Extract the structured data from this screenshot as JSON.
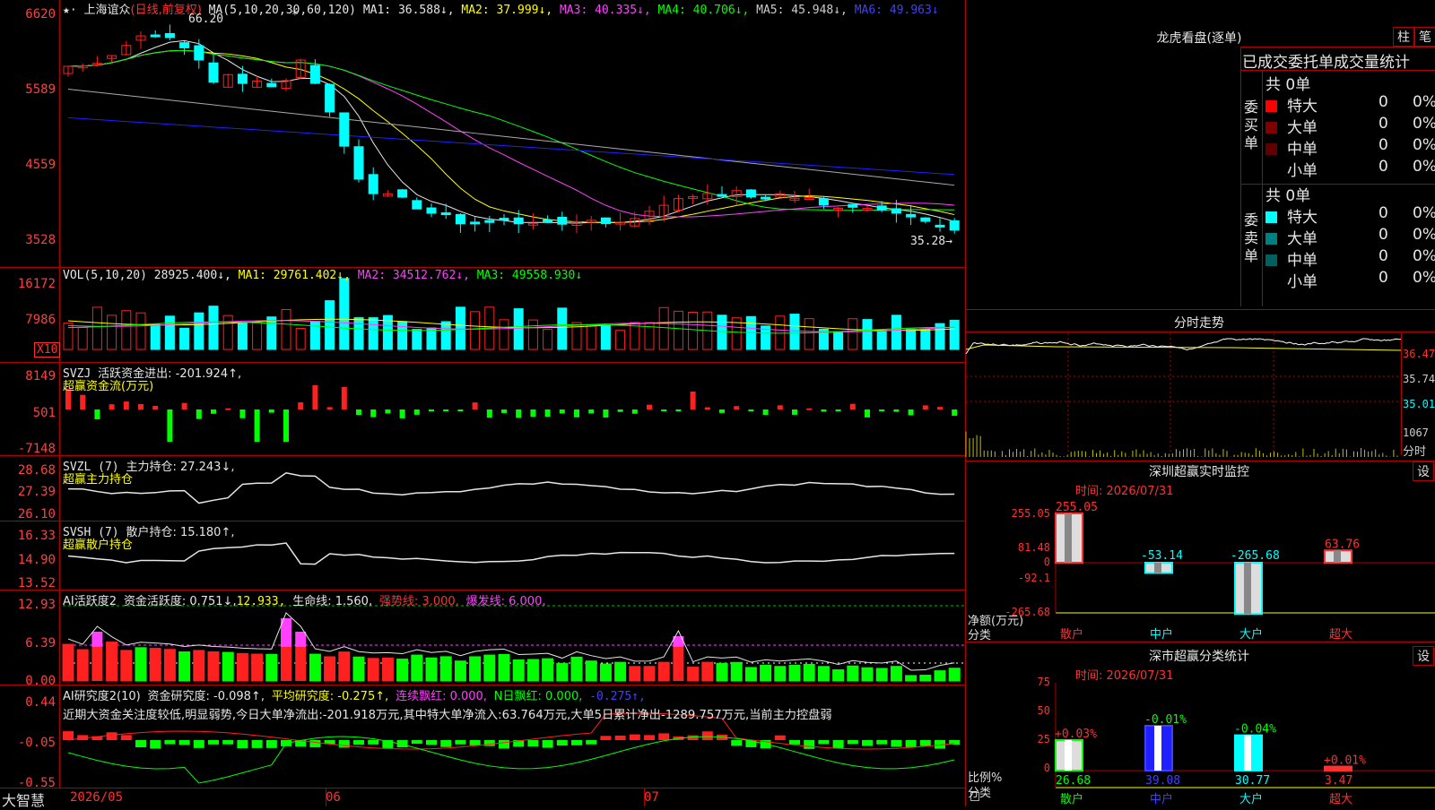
{
  "colors": {
    "grid": "#b00000",
    "up": "#ff2020",
    "down": "#00ffff",
    "green": "#00ff00",
    "magenta": "#ff40ff",
    "yellow": "#ffff00",
    "white": "#e6e6e6",
    "blue": "#2020ff",
    "gray": "#aaaaaa"
  },
  "main": {
    "stock_name": "上海谊众",
    "period_note": "(日线,前复权)",
    "ma_params": "MA(5,10,20,30,60,120)",
    "ma_values": [
      "MA1: 36.588↓,",
      "MA2: 37.999↓,",
      "MA3: 40.335↓,",
      "MA4: 40.706↓,",
      "MA5: 45.948↓,",
      "MA6: 49.963↓"
    ],
    "high_label": "66.20",
    "low_label": "35.28→",
    "y_labels": [
      "6620",
      "5589",
      "4559",
      "3528"
    ]
  },
  "vol": {
    "params": "VOL(5,10,20)",
    "v": "28925.400↓,",
    "ma1": "MA1: 29761.402↓,",
    "ma2": "MA2: 34512.762↓,",
    "ma3": "MA3: 49558.930↓",
    "y_labels": [
      "16172",
      "7986"
    ],
    "unit": "X10"
  },
  "svzj": {
    "title": "SVZJ",
    "label": "活跃资金进出: -201.924↑,",
    "sub": "超赢资金流(万元)",
    "y_labels": [
      "8149",
      "501",
      "-7148"
    ]
  },
  "svzl": {
    "title": "SVZL (7)",
    "label": "主力持仓: 27.243↓,",
    "sub": "超赢主力持仓",
    "y_labels": [
      "28.68",
      "27.39",
      "26.10"
    ]
  },
  "svsh": {
    "title": "SVSH (7)",
    "label": "散户持仓: 15.180↑,",
    "sub": "超赢散户持仓",
    "y_labels": [
      "16.33",
      "14.90",
      "13.52"
    ]
  },
  "ai1": {
    "title": "AI活跃度2",
    "t1": "资金活跃度: 0.751↓,",
    "t2": "12.933,",
    "t3": "生命线: 1.560,",
    "t4": "强势线: 3.000,",
    "t5": "爆发线: 6.000,",
    "y_labels": [
      "12.93",
      "6.39",
      "0.00"
    ]
  },
  "ai2": {
    "title": "AI研究度2(10)",
    "t1": "资金研究度: -0.098↑,",
    "t2": "平均研究度: -0.275↑,",
    "t3": "连续飘红: 0.000,",
    "t4": "N日飘红: 0.000,",
    "t5": "-0.275↑,",
    "comment": "近期大资金关注度较低,明显弱势,今日大单净流出:-201.918万元,其中特大单净流入:63.764万元,大单5日累计净出-1289.757万元,当前主力控盘弱",
    "y_labels": [
      "0.44",
      "-0.05",
      "-0.55"
    ]
  },
  "xaxis": {
    "brand": "大智慧",
    "labels": [
      "2026/05",
      "06",
      "07"
    ]
  },
  "lhb": {
    "title": "龙虎看盘(逐单)",
    "btn1": "柱",
    "btn2": "笔",
    "tabs": "已成交委托单成交量统计",
    "buy": {
      "label": "委买单",
      "count": "共 0单",
      "rows": [
        {
          "name": "特大",
          "val": "0",
          "pct": "0%"
        },
        {
          "name": "大单",
          "val": "0",
          "pct": "0%"
        },
        {
          "name": "中单",
          "val": "0",
          "pct": "0%"
        },
        {
          "name": "小单",
          "val": "0",
          "pct": "0%"
        }
      ]
    },
    "sell": {
      "label": "委卖单",
      "count": "共 0单",
      "rows": [
        {
          "name": "特大",
          "val": "0",
          "pct": "0%"
        },
        {
          "name": "大单",
          "val": "0",
          "pct": "0%"
        },
        {
          "name": "中单",
          "val": "0",
          "pct": "0%"
        },
        {
          "name": "小单",
          "val": "0",
          "pct": "0%"
        }
      ]
    }
  },
  "fenshi": {
    "title": "分时走势",
    "y_labels": [
      "36.47",
      "35.74",
      "35.01"
    ],
    "vol_label": "1067",
    "unit": "分时"
  },
  "szmon": {
    "title": "深圳超赢实时监控",
    "btn": "设",
    "time": "时间: 2026/07/31",
    "y_labels": [
      "255.05",
      "81.48",
      "0",
      "-92.1",
      "-265.68"
    ],
    "unit": "净额(万元)",
    "cat_label": "分类",
    "bars": [
      {
        "name": "散户",
        "value": 255.05,
        "label": "255.05"
      },
      {
        "name": "中户",
        "value": -53.14,
        "label": "-53.14"
      },
      {
        "name": "大户",
        "value": -265.68,
        "label": "-265.68"
      },
      {
        "name": "超大",
        "value": 63.76,
        "label": "63.76"
      }
    ]
  },
  "szcls": {
    "title": "深市超赢分类统计",
    "btn": "设",
    "time": "时间: 2026/07/31",
    "y_labels": [
      "75",
      "50",
      "25",
      "0"
    ],
    "unit": "比例%",
    "cat_label": "分类",
    "bars": [
      {
        "name": "散户",
        "value": 26.68,
        "label": "26.68",
        "change": "+0.03%"
      },
      {
        "name": "中户",
        "value": 39.08,
        "label": "39.08",
        "change": "-0.01%"
      },
      {
        "name": "大户",
        "value": 30.77,
        "label": "30.77",
        "change": "-0.04%"
      },
      {
        "name": "超大",
        "value": 3.47,
        "label": "3.47",
        "change": "+0.01%"
      }
    ]
  }
}
